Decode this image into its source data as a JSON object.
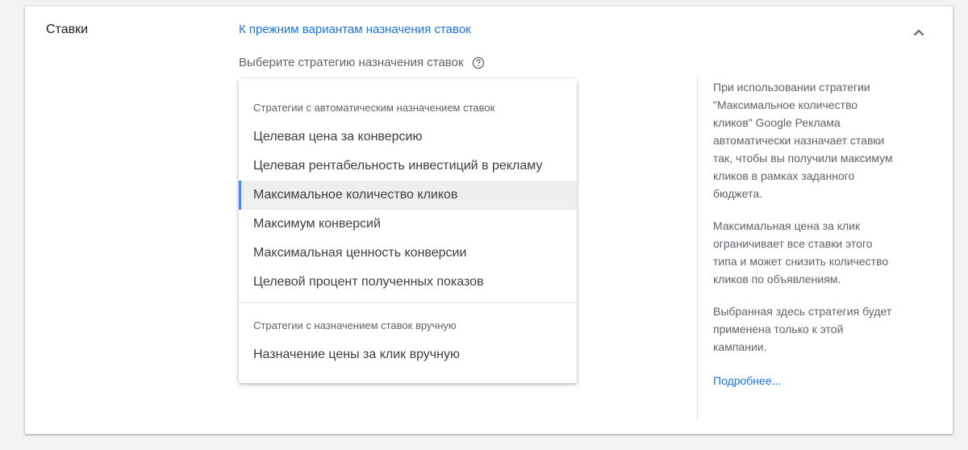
{
  "section": {
    "title": "Ставки"
  },
  "legacy_link": "К прежним вариантам назначения ставок",
  "strategy_prompt": "Выберите стратегию назначения ставок",
  "dropdown": {
    "auto_group_label": "Стратегии с автоматическим назначением ставок",
    "auto_options": [
      "Целевая цена за конверсию",
      "Целевая рентабельность инвестиций в рекламу",
      "Максимальное количество кликов",
      "Максимум конверсий",
      "Максимальная ценность конверсии",
      "Целевой процент полученных показов"
    ],
    "selected_option": "Максимальное количество кликов",
    "manual_group_label": "Стратегии с назначением ставок вручную",
    "manual_options": [
      "Назначение цены за клик вручную"
    ]
  },
  "description": {
    "paragraphs": [
      "При использовании стратегии \"Максимальное количество кликов\" Google Реклама автоматически назначает ставки так, чтобы вы получили максимум кликов в рамках заданного бюджета.",
      "Максимальная цена за клик ограничивает все ставки этого типа и может снизить количество кликов по объявлениям.",
      "Выбранная здесь стратегия будет применена только к этой кампании."
    ],
    "learn_more": "Подробнее..."
  },
  "icons": {
    "collapse": "chevron-up-icon",
    "help": "help-circle-icon"
  },
  "colors": {
    "link": "#1a73e8",
    "selected_indicator": "#4285f4",
    "selected_bg": "#eeeeee"
  }
}
